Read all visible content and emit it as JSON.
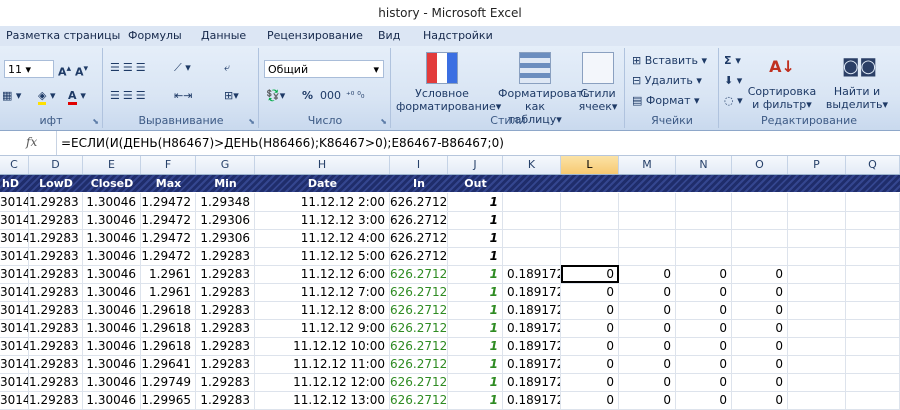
{
  "window": {
    "title": "history - Microsoft Excel"
  },
  "tabs": [
    "Разметка страницы",
    "Формулы",
    "Данные",
    "Рецензирование",
    "Вид",
    "Надстройки"
  ],
  "ribbon": {
    "font_group_label": "ифт",
    "font_size": "11",
    "alignment_group_label": "Выравнивание",
    "number_group_label": "Число",
    "number_format": "Общий",
    "styles_group_label": "Стили",
    "cond_format": "Условное форматирование",
    "format_table": "Форматировать как таблицу",
    "cell_styles": "Стили ячеек",
    "cells_group_label": "Ячейки",
    "insert": "Вставить",
    "delete": "Удалить",
    "format": "Формат",
    "editing_group_label": "Редактирование",
    "sort_filter": "Сортировка и фильтр",
    "find_select": "Найти и выделить",
    "percent": "%",
    "thousands": "000"
  },
  "formula_bar": {
    "fx": "fx",
    "formula": "=ЕСЛИ(И(ДЕНЬ(H86467)>ДЕНЬ(H86466);K86467>0);E86467-B86467;0)"
  },
  "columns": [
    "C",
    "D",
    "E",
    "F",
    "G",
    "H",
    "I",
    "J",
    "K",
    "L",
    "M",
    "N",
    "O",
    "P",
    "Q"
  ],
  "header_row": [
    "hD",
    "LowD",
    "CloseD",
    "Max",
    "Min",
    "Date",
    "In",
    "Out",
    "",
    "",
    "",
    "",
    "",
    "",
    ""
  ],
  "rows": [
    [
      "3014",
      "1.29283",
      "1.30046",
      "1.29472",
      "1.29348",
      "11.12.12 2:00",
      "626.2712",
      "1",
      "",
      "",
      "",
      "",
      ""
    ],
    [
      "3014",
      "1.29283",
      "1.30046",
      "1.29472",
      "1.29306",
      "11.12.12 3:00",
      "626.2712",
      "1",
      "",
      "",
      "",
      "",
      ""
    ],
    [
      "3014",
      "1.29283",
      "1.30046",
      "1.29472",
      "1.29306",
      "11.12.12 4:00",
      "626.2712",
      "1",
      "",
      "",
      "",
      "",
      ""
    ],
    [
      "3014",
      "1.29283",
      "1.30046",
      "1.29472",
      "1.29283",
      "11.12.12 5:00",
      "626.2712",
      "1",
      "",
      "",
      "",
      "",
      ""
    ],
    [
      "3014",
      "1.29283",
      "1.30046",
      "1.2961",
      "1.29283",
      "11.12.12 6:00",
      "626.2712",
      "1",
      "0.189172",
      "0",
      "0",
      "0",
      "0"
    ],
    [
      "3014",
      "1.29283",
      "1.30046",
      "1.2961",
      "1.29283",
      "11.12.12 7:00",
      "626.2712",
      "1",
      "0.189172",
      "0",
      "0",
      "0",
      "0"
    ],
    [
      "3014",
      "1.29283",
      "1.30046",
      "1.29618",
      "1.29283",
      "11.12.12 8:00",
      "626.2712",
      "1",
      "0.189172",
      "0",
      "0",
      "0",
      "0"
    ],
    [
      "3014",
      "1.29283",
      "1.30046",
      "1.29618",
      "1.29283",
      "11.12.12 9:00",
      "626.2712",
      "1",
      "0.189172",
      "0",
      "0",
      "0",
      "0"
    ],
    [
      "3014",
      "1.29283",
      "1.30046",
      "1.29618",
      "1.29283",
      "11.12.12 10:00",
      "626.2712",
      "1",
      "0.189172",
      "0",
      "0",
      "0",
      "0"
    ],
    [
      "3014",
      "1.29283",
      "1.30046",
      "1.29641",
      "1.29283",
      "11.12.12 11:00",
      "626.2712",
      "1",
      "0.189172",
      "0",
      "0",
      "0",
      "0"
    ],
    [
      "3014",
      "1.29283",
      "1.30046",
      "1.29749",
      "1.29283",
      "11.12.12 12:00",
      "626.2712",
      "1",
      "0.189172",
      "0",
      "0",
      "0",
      "0"
    ],
    [
      "3014",
      "1.29283",
      "1.30046",
      "1.29965",
      "1.29283",
      "11.12.12 13:00",
      "626.2712",
      "1",
      "0.189172",
      "0",
      "0",
      "0",
      "0"
    ]
  ],
  "colors": {
    "header_band": "#1f2d6b",
    "in_green": "#2e8b22",
    "selected_column": "#f7c972"
  }
}
